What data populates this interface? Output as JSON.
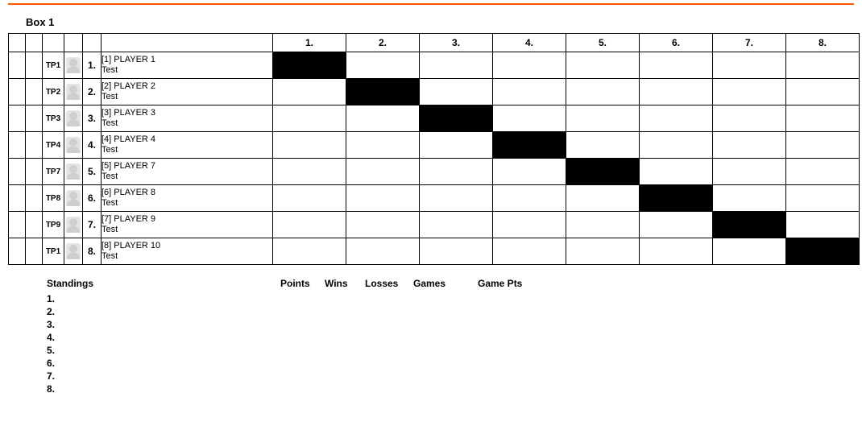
{
  "box_title": "Box 1",
  "columns": [
    "1.",
    "2.",
    "3.",
    "4.",
    "5.",
    "6.",
    "7.",
    "8."
  ],
  "players": [
    {
      "tp": "TP1",
      "rank": "1.",
      "line1": "[1] PLAYER 1",
      "line2": "Test"
    },
    {
      "tp": "TP2",
      "rank": "2.",
      "line1": "[2] PLAYER 2",
      "line2": "Test"
    },
    {
      "tp": "TP3",
      "rank": "3.",
      "line1": "[3] PLAYER 3",
      "line2": "Test"
    },
    {
      "tp": "TP4",
      "rank": "4.",
      "line1": "[4] PLAYER 4",
      "line2": "Test"
    },
    {
      "tp": "TP7",
      "rank": "5.",
      "line1": "[5] PLAYER 7",
      "line2": "Test"
    },
    {
      "tp": "TP8",
      "rank": "6.",
      "line1": "[6] PLAYER 8",
      "line2": "Test"
    },
    {
      "tp": "TP9",
      "rank": "7.",
      "line1": "[7] PLAYER 9",
      "line2": "Test"
    },
    {
      "tp": "TP1",
      "rank": "8.",
      "line1": "[8] PLAYER 10",
      "line2": "Test"
    }
  ],
  "standings": {
    "title": "Standings",
    "headers": {
      "points": "Points",
      "wins": "Wins",
      "losses": "Losses",
      "games": "Games",
      "game_pts": "Game Pts"
    },
    "rows": [
      "1.",
      "2.",
      "3.",
      "4.",
      "5.",
      "6.",
      "7.",
      "8."
    ]
  }
}
